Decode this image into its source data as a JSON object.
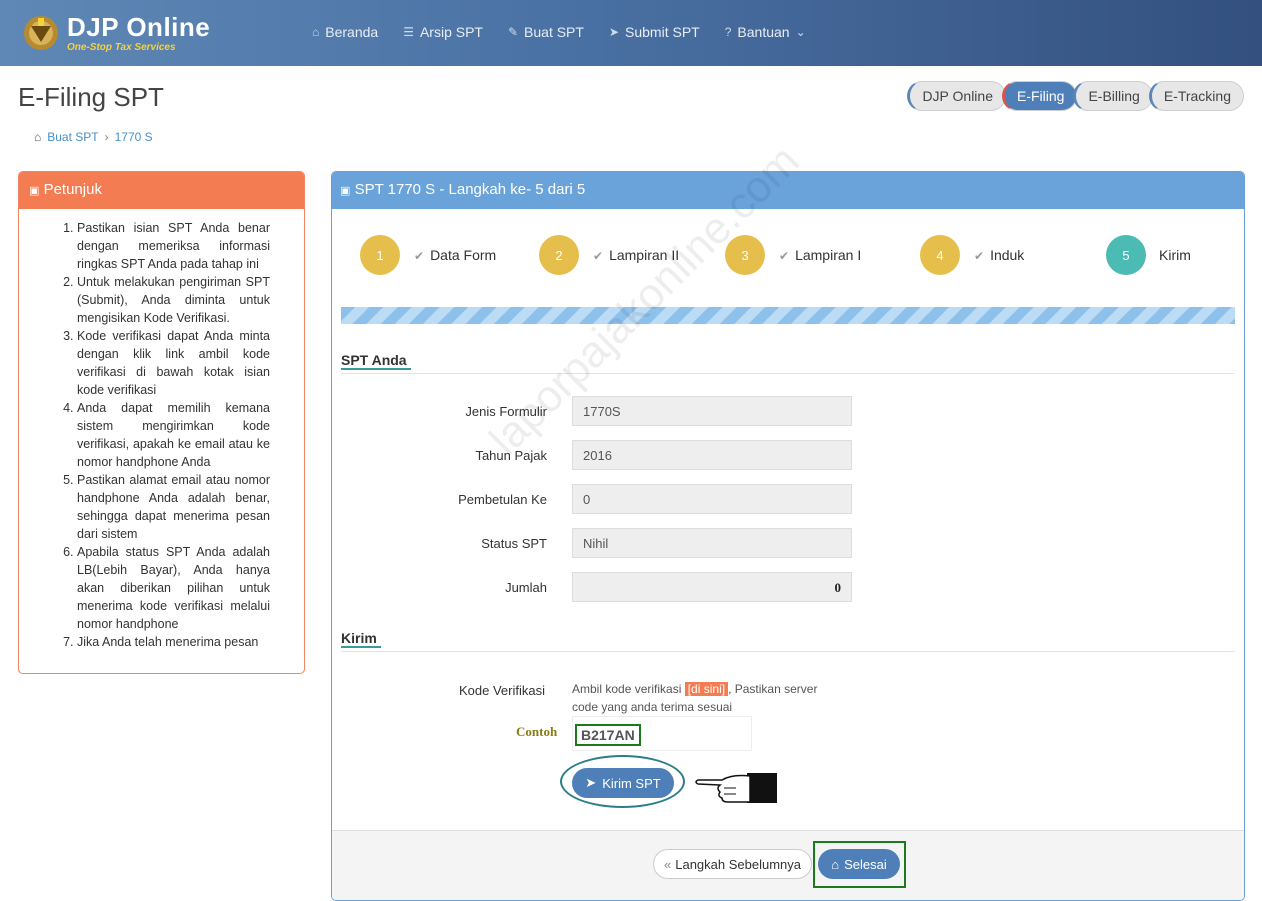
{
  "header": {
    "brand": "DJP Online",
    "tagline": "One-Stop Tax Services",
    "nav": [
      {
        "icon": "home-icon",
        "label": "Beranda"
      },
      {
        "icon": "list-icon",
        "label": "Arsip SPT"
      },
      {
        "icon": "edit-icon",
        "label": "Buat SPT"
      },
      {
        "icon": "paper-plane-icon",
        "label": "Submit SPT"
      },
      {
        "icon": "question-icon",
        "label": "Bantuan"
      }
    ],
    "bantuan_caret": "⌄"
  },
  "page": {
    "title": "E-Filing SPT",
    "module_tabs": [
      "DJP Online",
      "E-Filing",
      "E-Billing",
      "E-Tracking"
    ],
    "active_tab": "E-Filing",
    "breadcrumb": [
      "Buat SPT",
      "1770 S"
    ]
  },
  "petunjuk": {
    "title": "Petunjuk",
    "items": [
      "Pastikan isian SPT Anda benar dengan memeriksa informasi ringkas SPT Anda pada tahap ini",
      "Untuk melakukan pengiriman SPT (Submit), Anda diminta untuk mengisikan Kode Verifikasi.",
      "Kode verifikasi dapat Anda minta dengan klik link ambil kode verifikasi di bawah kotak isian kode verifikasi",
      "Anda dapat memilih kemana sistem mengirimkan kode verifikasi, apakah ke email atau ke nomor handphone Anda",
      "Pastikan alamat email atau nomor handphone Anda adalah benar, sehingga dapat menerima pesan dari sistem",
      "Apabila status SPT Anda adalah LB(Lebih Bayar), Anda hanya akan diberikan pilihan untuk menerima kode verifikasi melalui nomor handphone",
      "Jika Anda telah menerima pesan"
    ]
  },
  "main": {
    "title": "SPT 1770 S - Langkah ke- 5 dari 5",
    "steps": [
      {
        "num": "1",
        "label": "Data Form",
        "done": true
      },
      {
        "num": "2",
        "label": "Lampiran II",
        "done": true
      },
      {
        "num": "3",
        "label": "Lampiran I",
        "done": true
      },
      {
        "num": "4",
        "label": "Induk",
        "done": true
      },
      {
        "num": "5",
        "label": "Kirim",
        "done": false
      }
    ],
    "spt_section": "SPT Anda",
    "fields": [
      {
        "label": "Jenis Formulir",
        "value": "1770S"
      },
      {
        "label": "Tahun Pajak",
        "value": "2016"
      },
      {
        "label": "Pembetulan Ke",
        "value": "0"
      },
      {
        "label": "Status SPT",
        "value": "Nihil"
      },
      {
        "label": "Jumlah",
        "value": "0"
      }
    ],
    "kirim_section": "Kirim",
    "kode_label": "Kode Verifikasi",
    "kode_hint_before": "Ambil kode verifikasi ",
    "kode_link": "[di sini]",
    "kode_hint_after": ", Pastikan server code yang anda terima sesuai",
    "contoh_label": "Contoh",
    "kode_example": "B217AN",
    "kirim_button": "Kirim SPT",
    "prev_button": "Langkah Sebelumnya",
    "done_button": "Selesai"
  },
  "watermark": "laporpajakonline.com"
}
